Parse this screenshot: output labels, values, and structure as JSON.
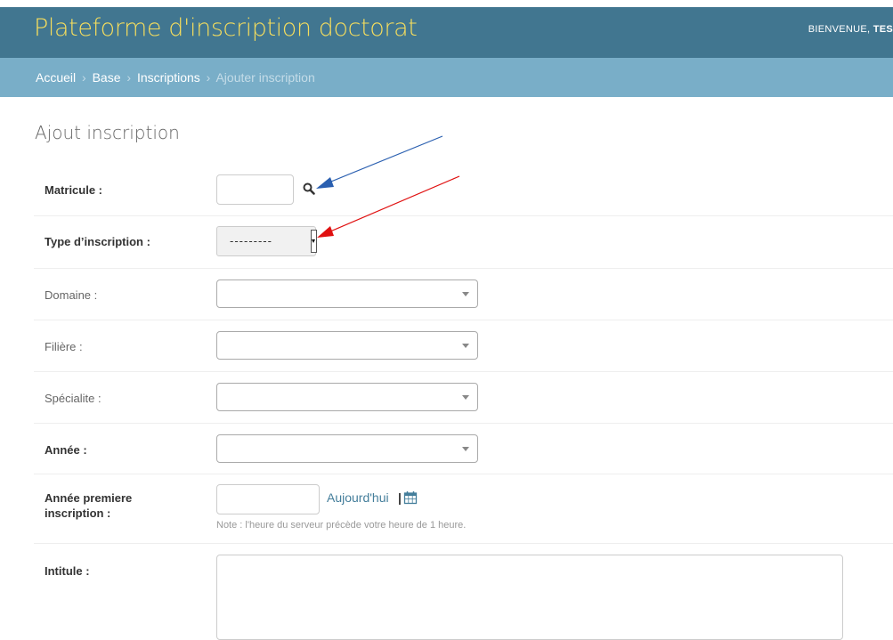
{
  "header": {
    "brand": "Plateforme d'inscription doctorat",
    "welcome": "BIENVENUE,",
    "user": "TES"
  },
  "breadcrumbs": [
    "Accueil",
    "Base",
    "Inscriptions",
    "Ajouter inscription"
  ],
  "page_title": "Ajout inscription",
  "form": {
    "matricule": {
      "label": "Matricule :",
      "value": ""
    },
    "type_inscription": {
      "label": "Type d’inscription :",
      "value": "---------"
    },
    "domaine": {
      "label": "Domaine :",
      "value": ""
    },
    "filiere": {
      "label": "Filière :",
      "value": ""
    },
    "specialite": {
      "label": "Spécialite :",
      "value": ""
    },
    "annee": {
      "label": "Année :",
      "value": ""
    },
    "annee_premiere": {
      "label_line1": "Année premiere",
      "label_line2": "inscription :",
      "value": "",
      "today_link": "Aujourd'hui",
      "separator": "|",
      "note": "Note : l'heure du serveur précède votre heure de 1 heure."
    },
    "intitule": {
      "label": "Intitule :",
      "value": ""
    }
  },
  "icons": {
    "search": "search-icon",
    "calendar": "calendar-icon",
    "blue_arrow": "annotation-arrow-blue",
    "red_arrow": "annotation-arrow-red"
  },
  "colors": {
    "header_bg": "#417690",
    "brand_text": "#f5dd5d",
    "breadcrumbs_bg": "#79aec8",
    "link": "#447e9b",
    "annotation_blue": "#2a5fb0",
    "annotation_red": "#e01010"
  }
}
